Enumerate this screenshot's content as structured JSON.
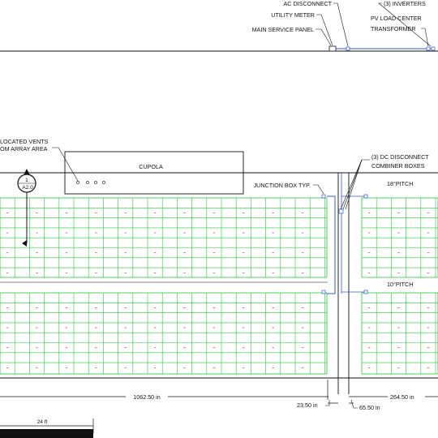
{
  "colors": {
    "background": "#ffffff",
    "linework": "#111111",
    "module_grid": "#22cc33",
    "conduit": "#3355cc",
    "tick_mark": "#cc3355"
  },
  "labels": {
    "ac_disconnect": "AC DISCONNECT",
    "utility_meter": "UTILITY METER",
    "main_service_panel": "MAIN SERVICE PANEL",
    "inverters": "(3) INVERTERS",
    "pv_load_center": "PV LOAD CENTER",
    "transformer": "TRANSFORMER",
    "relocated_vents_line1": "LOCATED VENTS",
    "relocated_vents_line2": "OM ARRAY AREA",
    "cupola": "CUPOLA",
    "section_ref_number": "1",
    "section_ref_sheet": "A2.0",
    "junction_box": "JUNCTION BOX TYP.",
    "dc_disconnect_line1": "(3) DC DISCONNECT",
    "dc_disconnect_line2": "COMBINER BOXES",
    "pitch_upper": "18°PITCH",
    "pitch_lower": "10°PITCH"
  },
  "dimensions": {
    "main_length": "1062.50 in",
    "gap_left": "23.50 in",
    "gap_right": "65.50 in",
    "right_length": "264.50 in"
  },
  "scale_bar": {
    "label": "24 ft"
  }
}
